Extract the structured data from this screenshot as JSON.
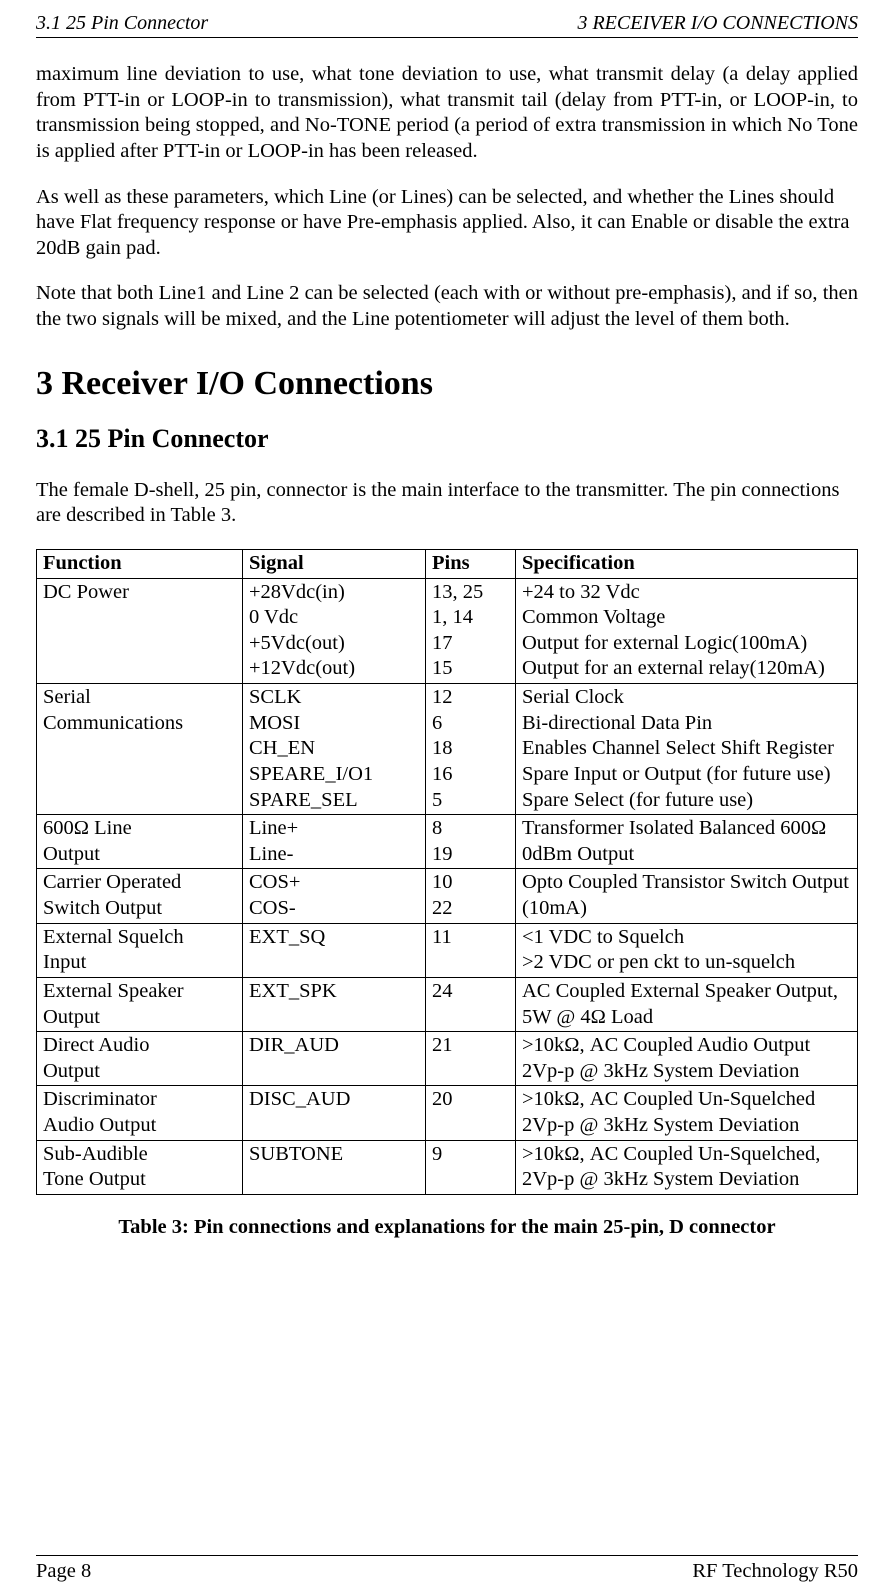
{
  "header": {
    "left": "3.1  25 Pin Connector",
    "right": "3  RECEIVER I/O CONNECTIONS"
  },
  "paragraphs": {
    "p1": "maximum line deviation to use, what tone deviation to use, what transmit delay (a delay applied from PTT-in or LOOP-in to transmission), what transmit tail (delay from PTT-in, or LOOP-in, to transmission being stopped, and No-TONE period (a period of extra transmission in which No Tone is applied after PTT-in or LOOP-in has been released.",
    "p2": "As well as these parameters, which Line (or Lines) can be selected, and whether the Lines should have Flat frequency response or have Pre-emphasis applied.  Also, it can Enable or disable the extra 20dB gain pad.",
    "p3": "Note that both Line1 and Line 2 can be selected (each with or without pre-emphasis), and if so, then the two signals will be mixed, and the Line potentiometer will adjust the level of them both."
  },
  "headings": {
    "h1": "3    Receiver I/O Connections",
    "h2": "3.1  25 Pin Connector"
  },
  "intro": "The female D-shell, 25 pin, connector is the main interface to the transmitter. The pin connections are described in Table 3.",
  "table": {
    "headers": {
      "function": "Function",
      "signal": "Signal",
      "pins": "Pins",
      "spec": "Specification"
    },
    "rows": [
      {
        "function": [
          "DC Power"
        ],
        "signal": [
          "+28Vdc(in)",
          "0 Vdc",
          "+5Vdc(out)",
          "+12Vdc(out)"
        ],
        "pins": [
          "13, 25",
          "1, 14",
          "17",
          "15"
        ],
        "spec": [
          "+24 to 32 Vdc",
          "Common Voltage",
          "Output for external Logic(100mA)",
          "Output for an external relay(120mA)"
        ]
      },
      {
        "function": [
          "Serial",
          "Communications"
        ],
        "signal": [
          "SCLK",
          "MOSI",
          "CH_EN",
          "SPEARE_I/O1",
          "SPARE_SEL"
        ],
        "pins": [
          "12",
          "6",
          "18",
          "16",
          "5"
        ],
        "spec": [
          "Serial Clock",
          "Bi-directional Data Pin",
          "Enables Channel Select Shift Register",
          "Spare Input or Output (for future use)",
          "Spare Select (for future use)"
        ]
      },
      {
        "function": [
          "600Ω Line",
          "Output"
        ],
        "signal": [
          "Line+",
          "Line-"
        ],
        "pins": [
          "8",
          "19"
        ],
        "spec": [
          "Transformer Isolated Balanced 600Ω 0dBm Output"
        ]
      },
      {
        "function": [
          "Carrier Operated",
          "Switch Output"
        ],
        "signal": [
          "COS+",
          "COS-"
        ],
        "pins": [
          "10",
          "22"
        ],
        "spec": [
          "Opto Coupled Transistor Switch Output (10mA)"
        ]
      },
      {
        "function": [
          "External Squelch",
          "Input"
        ],
        "signal": [
          "EXT_SQ"
        ],
        "pins": [
          "11"
        ],
        "spec": [
          "<1 VDC to Squelch",
          ">2 VDC or pen ckt to un-squelch"
        ]
      },
      {
        "function": [
          "External Speaker",
          "Output"
        ],
        "signal": [
          "EXT_SPK"
        ],
        "pins": [
          "24"
        ],
        "spec": [
          "AC Coupled External Speaker Output, 5W @ 4Ω Load"
        ]
      },
      {
        "function": [
          "Direct Audio",
          "Output"
        ],
        "signal": [
          "DIR_AUD"
        ],
        "pins": [
          "21"
        ],
        "spec": [
          ">10kΩ, AC Coupled Audio Output 2Vp-p @ 3kHz System Deviation"
        ]
      },
      {
        "function": [
          "Discriminator",
          "Audio Output"
        ],
        "signal": [
          "DISC_AUD"
        ],
        "pins": [
          "20"
        ],
        "spec": [
          ">10kΩ, AC Coupled Un-Squelched 2Vp-p @ 3kHz System Deviation"
        ]
      },
      {
        "function": [
          "Sub-Audible",
          "Tone Output"
        ],
        "signal": [
          "SUBTONE"
        ],
        "pins": [
          "9"
        ],
        "spec": [
          ">10kΩ, AC Coupled Un-Squelched, 2Vp-p @ 3kHz System Deviation"
        ]
      }
    ],
    "caption": "Table 3:  Pin connections and explanations for the main 25-pin, D connector"
  },
  "footer": {
    "left": "Page 8",
    "right": "RF Technology   R50"
  }
}
